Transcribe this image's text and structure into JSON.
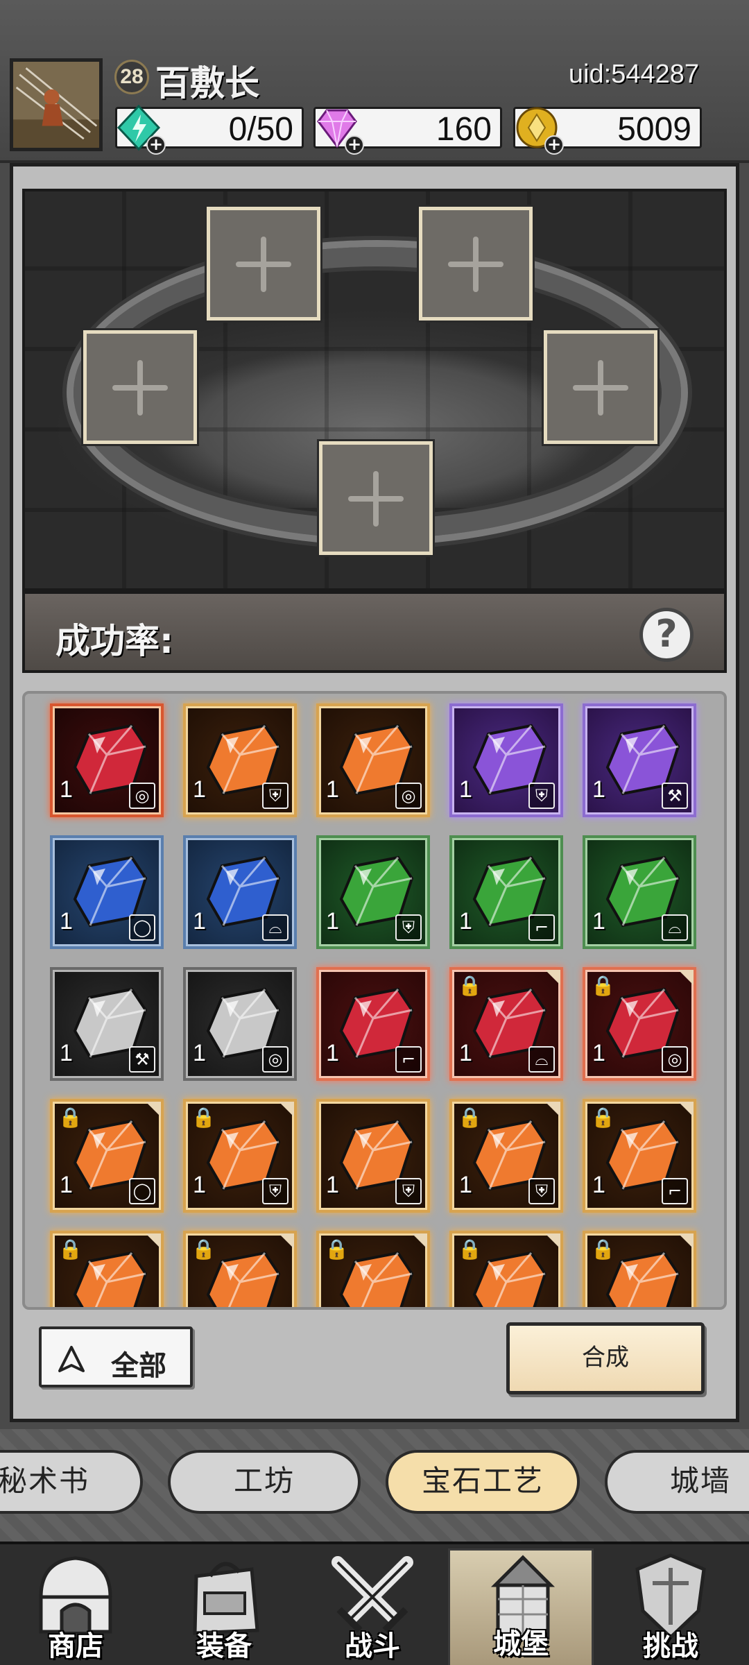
{
  "player": {
    "level": "28",
    "name": "百敷长",
    "uid": "uid:544287"
  },
  "resources": [
    {
      "name": "energy",
      "value": "0/50",
      "color": "#2fc9a8"
    },
    {
      "name": "diamond",
      "value": "160",
      "color": "#e07ae8"
    },
    {
      "name": "gold",
      "value": "5009",
      "color": "#e0b020"
    }
  ],
  "crafting": {
    "slots": 5,
    "success_rate_label": "成功率:",
    "help": "?"
  },
  "gems": [
    {
      "quality": "q-red",
      "color": "#d0283a",
      "count": "1",
      "type": "necklace",
      "glyph": "◎",
      "locked": false
    },
    {
      "quality": "q-orange",
      "color": "#ef7a2f",
      "count": "1",
      "type": "armor",
      "glyph": "⛨",
      "locked": false
    },
    {
      "quality": "q-orange",
      "color": "#ef7a2f",
      "count": "1",
      "type": "necklace",
      "glyph": "◎",
      "locked": false
    },
    {
      "quality": "q-purple",
      "color": "#8a54d8",
      "count": "1",
      "type": "armor",
      "glyph": "⛨",
      "locked": false
    },
    {
      "quality": "q-purple",
      "color": "#8a54d8",
      "count": "1",
      "type": "weapon",
      "glyph": "⚒",
      "locked": false
    },
    {
      "quality": "q-blue",
      "color": "#2f5fcf",
      "count": "1",
      "type": "ring",
      "glyph": "◯",
      "locked": false
    },
    {
      "quality": "q-blue",
      "color": "#2f5fcf",
      "count": "1",
      "type": "helmet",
      "glyph": "⌓",
      "locked": false
    },
    {
      "quality": "q-green",
      "color": "#3aa53a",
      "count": "1",
      "type": "armor",
      "glyph": "⛨",
      "locked": false
    },
    {
      "quality": "q-green",
      "color": "#3aa53a",
      "count": "1",
      "type": "boots",
      "glyph": "⌐",
      "locked": false
    },
    {
      "quality": "q-green",
      "color": "#3aa53a",
      "count": "1",
      "type": "helmet",
      "glyph": "⌓",
      "locked": false
    },
    {
      "quality": "q-grey",
      "color": "#c8c8c8",
      "count": "1",
      "type": "weapon",
      "glyph": "⚒",
      "locked": false
    },
    {
      "quality": "q-grey",
      "color": "#c8c8c8",
      "count": "1",
      "type": "necklace",
      "glyph": "◎",
      "locked": false
    },
    {
      "quality": "q-red2",
      "color": "#d0283a",
      "count": "1",
      "type": "boots",
      "glyph": "⌐",
      "locked": false
    },
    {
      "quality": "q-red2",
      "color": "#d0283a",
      "count": "1",
      "type": "helmet",
      "glyph": "⌓",
      "locked": true
    },
    {
      "quality": "q-red2",
      "color": "#d0283a",
      "count": "1",
      "type": "necklace",
      "glyph": "◎",
      "locked": true
    },
    {
      "quality": "q-orange",
      "color": "#ef7a2f",
      "count": "1",
      "type": "ring",
      "glyph": "◯",
      "locked": true
    },
    {
      "quality": "q-orange",
      "color": "#ef7a2f",
      "count": "1",
      "type": "armor",
      "glyph": "⛨",
      "locked": true
    },
    {
      "quality": "q-orange",
      "color": "#ef7a2f",
      "count": "1",
      "type": "armor",
      "glyph": "⛨",
      "locked": false
    },
    {
      "quality": "q-orange",
      "color": "#ef7a2f",
      "count": "1",
      "type": "armor",
      "glyph": "⛨",
      "locked": true
    },
    {
      "quality": "q-orange",
      "color": "#ef7a2f",
      "count": "1",
      "type": "boots",
      "glyph": "⌐",
      "locked": true
    },
    {
      "quality": "q-orange",
      "color": "#ef7a2f",
      "count": "",
      "type": "",
      "glyph": "",
      "locked": true
    },
    {
      "quality": "q-orange",
      "color": "#ef7a2f",
      "count": "",
      "type": "",
      "glyph": "",
      "locked": true
    },
    {
      "quality": "q-orange",
      "color": "#ef7a2f",
      "count": "",
      "type": "",
      "glyph": "",
      "locked": true
    },
    {
      "quality": "q-orange",
      "color": "#ef7a2f",
      "count": "",
      "type": "",
      "glyph": "",
      "locked": true
    },
    {
      "quality": "q-orange",
      "color": "#ef7a2f",
      "count": "",
      "type": "",
      "glyph": "",
      "locked": true
    }
  ],
  "controls": {
    "filter_label": "全部",
    "synthesize_label": "合成"
  },
  "subtabs": [
    {
      "label": "秘术书",
      "active": false
    },
    {
      "label": "工坊",
      "active": false
    },
    {
      "label": "宝石工艺",
      "active": true
    },
    {
      "label": "城墙",
      "active": false
    }
  ],
  "nav": [
    {
      "label": "商店",
      "icon": "shop-icon",
      "active": false
    },
    {
      "label": "装备",
      "icon": "backpack-icon",
      "active": false
    },
    {
      "label": "战斗",
      "icon": "crossed-swords-icon",
      "active": false
    },
    {
      "label": "城堡",
      "icon": "castle-icon",
      "active": true
    },
    {
      "label": "挑战",
      "icon": "shield-icon",
      "active": false
    }
  ]
}
